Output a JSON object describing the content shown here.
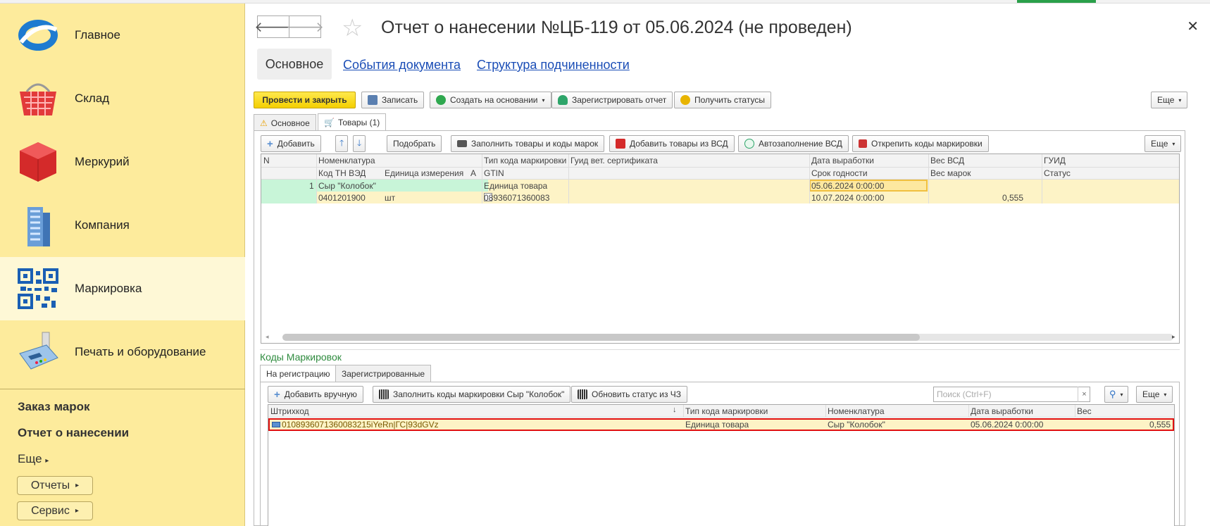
{
  "sidebar": {
    "items": [
      {
        "label": "Главное",
        "icon": "main-globe-icon"
      },
      {
        "label": "Склад",
        "icon": "basket-icon"
      },
      {
        "label": "Меркурий",
        "icon": "cube-icon"
      },
      {
        "label": "Компания",
        "icon": "building-icon"
      },
      {
        "label": "Маркировка",
        "icon": "qr-code-icon"
      },
      {
        "label": "Печать и оборудование",
        "icon": "payment-terminal-icon"
      }
    ],
    "links": [
      "Заказ марок",
      "Отчет о нанесении"
    ],
    "more": "Еще",
    "buttons": [
      "Отчеты",
      "Сервис"
    ]
  },
  "header": {
    "title": "Отчет о нанесении №ЦБ-119 от 05.06.2024 (не проведен)",
    "tabs": [
      "Основное",
      "События документа",
      "Структура подчиненности"
    ]
  },
  "toolbar": {
    "post_close": "Провести и закрыть",
    "save": "Записать",
    "create_based": "Создать на основании",
    "register_report": "Зарегистрировать отчет",
    "get_statuses": "Получить статусы",
    "more": "Еще"
  },
  "inner_tabs": [
    "Основное",
    "Товары (1)"
  ],
  "goods_toolbar": {
    "add": "Добавить",
    "pick": "Подобрать",
    "fill_goods": "Заполнить товары и коды марок",
    "add_from_vsd": "Добавить товары из ВСД",
    "autofill_vsd": "Автозаполнение ВСД",
    "unpin_codes": "Открепить коды маркировки",
    "more": "Еще"
  },
  "goods_table": {
    "headers_row1": [
      "N",
      "Номенклатура",
      "Тип кода маркировки",
      "Гуид вет. сертификата",
      "Дата выработки",
      "Вес ВСД",
      "ГУИД"
    ],
    "headers_row2": [
      "Код ТН ВЭД",
      "Единица измерения",
      "А",
      "GTIN",
      "Срок годности",
      "Вес марок",
      "Статус"
    ],
    "row1": {
      "n": "1",
      "nomenclature": "Сыр \"Колобок\"",
      "code_type": "Единица товара",
      "production_date": "05.06.2024 0:00:00"
    },
    "row2": {
      "tnved": "0401201900",
      "unit": "шт",
      "gtin": "08936071360083",
      "expiry": "10.07.2024 0:00:00",
      "weight": "0,555"
    }
  },
  "codes_section": {
    "title": "Коды Маркировок",
    "tabs": [
      "На регистрацию",
      "Зарегистрированные"
    ],
    "add_manual": "Добавить вручную",
    "fill_codes": "Заполнить коды маркировки Сыр \"Колобок\"",
    "refresh_status": "Обновить статус из ЧЗ",
    "search_placeholder": "Поиск (Ctrl+F)",
    "more": "Еще",
    "headers": [
      "Штрихкод",
      "Тип кода маркировки",
      "Номенклатура",
      "Дата выработки",
      "Вес"
    ],
    "rows": [
      {
        "barcode": "0108936071360083215iYeRn|ГС|93dGVz",
        "code_type": "Единица товара",
        "nomenclature": "Сыр \"Колобок\"",
        "date": "05.06.2024 0:00:00",
        "weight": "0,555"
      }
    ]
  },
  "colors": {
    "sidebar": "#fdeb9c",
    "primary_button": "#f4cf00",
    "link": "#1a4db6",
    "row_highlight": "#fdf3c6",
    "selected_green": "#c8f5d8",
    "selection_outline": "#e01010"
  }
}
